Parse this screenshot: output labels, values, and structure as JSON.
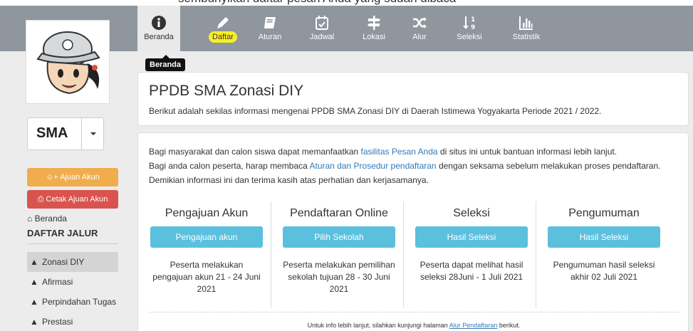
{
  "top_text": "sembunyikan daftar pesan Anda yang sudah dibaca",
  "nav": {
    "items": [
      {
        "label": "Beranda",
        "icon": "info-icon"
      },
      {
        "label": "Daftar",
        "icon": "pencil-icon"
      },
      {
        "label": "Aturan",
        "icon": "book-icon"
      },
      {
        "label": "Jadwal",
        "icon": "calendar-icon"
      },
      {
        "label": "Lokasi",
        "icon": "signpost-icon"
      },
      {
        "label": "Alur",
        "icon": "shuffle-icon"
      },
      {
        "label": "Seleksi",
        "icon": "sort-numeric-icon"
      },
      {
        "label": "Statistik",
        "icon": "bar-chart-icon"
      }
    ],
    "tooltip": "Beranda",
    "highlight_color": "#f7ee2b",
    "bar_color": "#8f969d"
  },
  "sidebar": {
    "level": "SMA",
    "ajuan_akun": "Ajuan Akun",
    "cetak_ajuan": "Cetak Ajuan Akun",
    "beranda": "Beranda",
    "daftar_jalur_title": "DAFTAR JALUR",
    "jalur": [
      "Zonasi DIY",
      "Afirmasi",
      "Perpindahan Tugas",
      "Prestasi"
    ]
  },
  "header": {
    "title": "PPDB SMA Zonasi DIY",
    "subtitle": "Berikut adalah sekilas informasi mengenai PPDB SMA Zonasi DIY di Daerah Istimewa Yogyakarta Periode 2021 / 2022."
  },
  "intro": {
    "p1_a": "Bagi masyarakat dan calon siswa dapat memanfaatkan ",
    "p1_link": "fasilitas Pesan Anda",
    "p1_b": " di situs ini untuk bantuan informasi lebih lanjut.",
    "p2_a": "Bagi anda calon peserta, harap membaca ",
    "p2_link": "Aturan dan Prosedur pendaftaran",
    "p2_b": " dengan seksama sebelum melakukan proses pendaftaran. Demikian informasi ini dan terima kasih atas perhatian dan kerjasamanya."
  },
  "columns": [
    {
      "title": "Pengajuan Akun",
      "button": "Pengajuan akun",
      "desc": "Peserta melakukan pengajuan akun 21 - 24 Juni 2021"
    },
    {
      "title": "Pendaftaran Online",
      "button": "Pilih Sekolah",
      "desc": "Peserta melakukan pemilihan sekolah tujuan 28 - 30 Juni 2021"
    },
    {
      "title": "Seleksi",
      "button": "Hasil Seleksi",
      "desc": "Peserta dapat melihat hasil seleksi 28Juni - 1 Juli 2021"
    },
    {
      "title": "Pengumuman",
      "button": "Hasil Seleksi",
      "desc": "Pengumuman hasil seleksi akhir 02 Juli 2021"
    }
  ],
  "footer": {
    "text_a": "Untuk info lebih lanjut, silahkan kunjungi halaman ",
    "link": "Alur Pendaftaran",
    "text_b": " berikut."
  }
}
